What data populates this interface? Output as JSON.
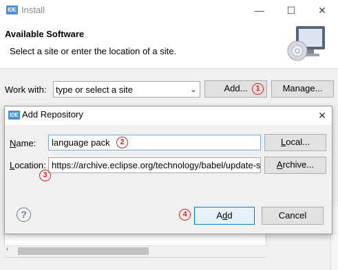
{
  "window": {
    "icon_text": "IDE",
    "title": "Install",
    "minimize": "—",
    "maximize": "☐",
    "close": "✕"
  },
  "header": {
    "title": "Available Software",
    "subtitle": "Select a site or enter the location of a site."
  },
  "work_with": {
    "label": "Work with:",
    "value": "type or select a site",
    "add_button": "Add...",
    "manage_button": "Manage..."
  },
  "dialog": {
    "icon_text": "IDE",
    "title": "Add Repository",
    "close": "✕",
    "name_label_u": "N",
    "name_label_rest": "ame:",
    "name_value": "language pack",
    "local_button_u": "L",
    "local_button_rest": "ocal...",
    "location_label_u": "L",
    "location_label_rest": "ocation:",
    "location_value": "https://archive.eclipse.org/technology/babel/update-site/",
    "archive_button_u": "A",
    "archive_button_rest": "rchive...",
    "help": "?",
    "add_button_a": "A",
    "add_button_u": "d",
    "add_button_rest": "d",
    "cancel_button": "Cancel"
  },
  "annotations": {
    "step1": "1",
    "step2": "2",
    "step3": "3",
    "step4": "4"
  },
  "colors": {
    "annotation_red": "#e02020",
    "accent_blue": "#0078d7",
    "ide_badge": "#4a90d9"
  }
}
